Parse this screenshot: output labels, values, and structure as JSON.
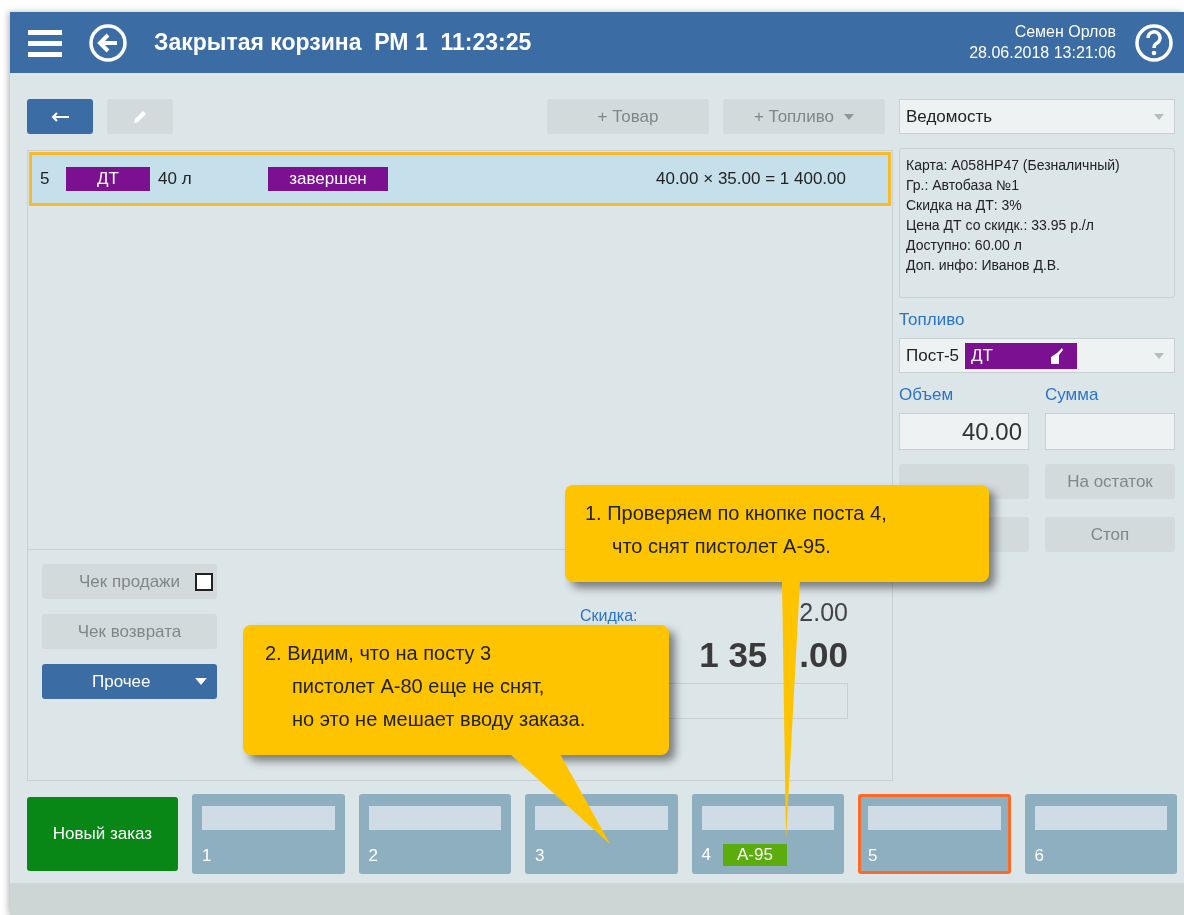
{
  "header": {
    "title": "Закрытая корзина  РМ 1  11:23:25",
    "user": "Семен Орлов",
    "datetime": "28.06.2018 13:21:06"
  },
  "toolbar": {
    "add_goods": "+ Товар",
    "add_fuel": "+ Топливо",
    "payment": "Ведомость"
  },
  "order_rows": [
    {
      "number": "5",
      "fuel": "ДТ",
      "volume": "40 л",
      "status": "завершен",
      "calc": "40.00 × 35.00 =  1 400.00",
      "selected": true
    }
  ],
  "card_info": [
    "Карта: А058НР47 (Безналичный)",
    "Гр.: Автобаза №1",
    "Скидка на ДТ: 3%",
    "Цена ДТ со скидк.: 33.95 р./л",
    "Доступно: 60.00 л",
    "Доп. инфо: Иванов Д.В."
  ],
  "fuel": {
    "label": "Топливо",
    "post": "Пост-5",
    "fuel": "ДТ"
  },
  "volume": {
    "label": "Объем",
    "value": "40.00"
  },
  "amount": {
    "label": "Сумма"
  },
  "fuel_buttons": [
    {
      "label": "На остаток"
    },
    {
      "label": "Стоп"
    }
  ],
  "receipt": {
    "sale": "Чек продажи",
    "sale_checked": false,
    "return": "Чек возврата",
    "other": "Прочее"
  },
  "totals": {
    "discount_label": "Скидка:",
    "discount_value": "2.00",
    "total_parts": [
      "1 35",
      ".00"
    ]
  },
  "new_order": "Новый заказ",
  "posts": [
    {
      "number": "1",
      "selected": false
    },
    {
      "number": "2",
      "selected": false
    },
    {
      "number": "3",
      "selected": false
    },
    {
      "number": "4",
      "nozzle": "А-95",
      "selected": false
    },
    {
      "number": "5",
      "selected": true
    },
    {
      "number": "6",
      "selected": false
    }
  ],
  "callouts": [
    "1. Проверяем по кнопке поста 4,\nчто снят пистолет А-95.",
    "2. Видим, что на посту 3\nпистолет А-80 еще не снят,\nно это не мешает вводу заказа."
  ]
}
